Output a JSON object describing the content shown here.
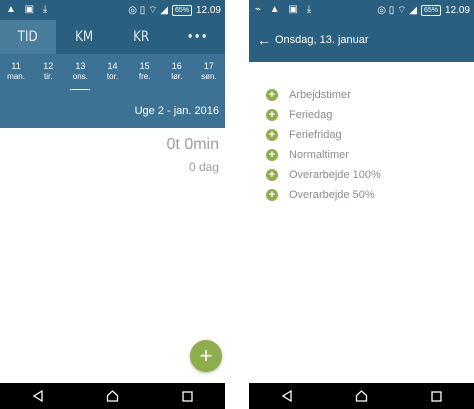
{
  "status_bar": {
    "time": "12.09",
    "battery": "65%"
  },
  "left": {
    "tabs": [
      "TID",
      "KM",
      "KR",
      "•••"
    ],
    "days": [
      {
        "num": "11",
        "label": "man."
      },
      {
        "num": "12",
        "label": "tir."
      },
      {
        "num": "13",
        "label": "ons."
      },
      {
        "num": "14",
        "label": "tor."
      },
      {
        "num": "15",
        "label": "fre."
      },
      {
        "num": "16",
        "label": "lør."
      },
      {
        "num": "17",
        "label": "søn."
      }
    ],
    "week_label": "Uge 2 - jan. 2016",
    "total_time": "0t 0min",
    "total_days": "0 dag",
    "fab_label": "+"
  },
  "right": {
    "title": "Onsdag, 13. januar",
    "items": [
      "Arbejdstimer",
      "Feriedag",
      "Feriefridag",
      "Normaltimer",
      "Overarbejde 100%",
      "Overarbejde 50%"
    ]
  },
  "colors": {
    "primary": "#2b5f7f",
    "calendar": "#3d7294",
    "accent": "#8fae4b"
  }
}
